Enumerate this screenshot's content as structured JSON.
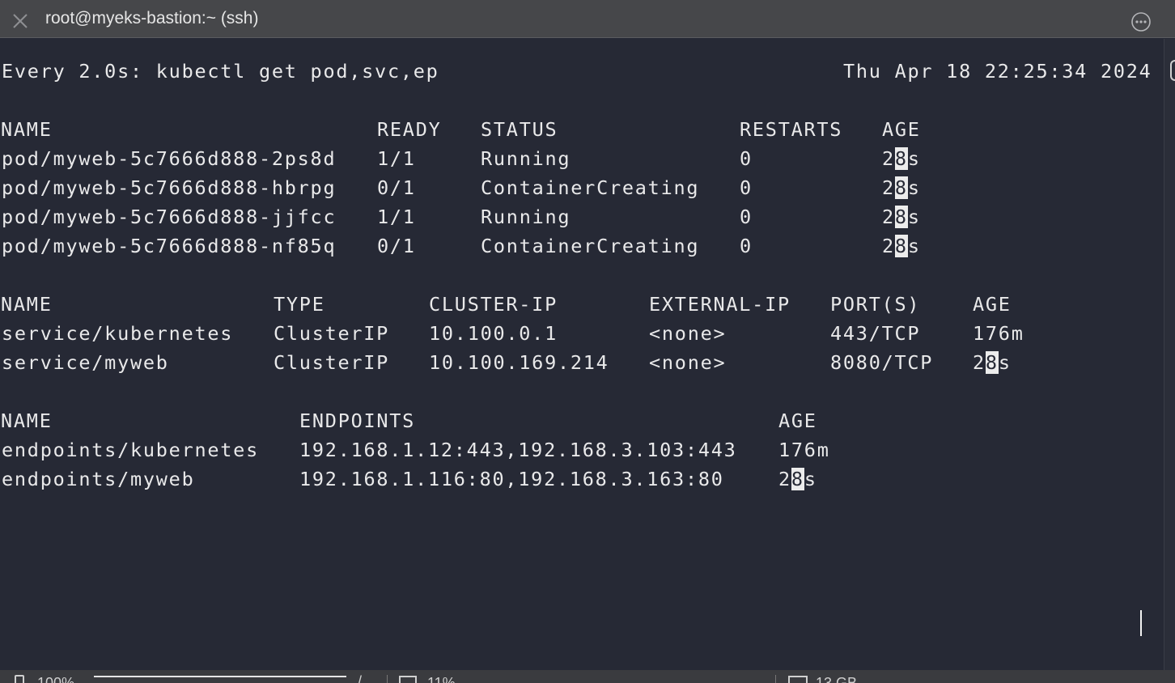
{
  "window": {
    "title": "root@myeks-bastion:~ (ssh)"
  },
  "watch": {
    "header": "Every 2.0s: kubectl get pod,svc,ep",
    "timestamp": "Thu Apr 18 22:25:34 2024"
  },
  "pods": {
    "headers": [
      "NAME",
      "READY",
      "STATUS",
      "RESTARTS",
      "AGE"
    ],
    "rows": [
      {
        "name": "pod/myweb-5c7666d888-2ps8d",
        "ready": "1/1",
        "status": "Running",
        "restarts": "0",
        "age_a": "2",
        "age_b": "8",
        "age_c": "s"
      },
      {
        "name": "pod/myweb-5c7666d888-hbrpg",
        "ready": "0/1",
        "status": "ContainerCreating",
        "restarts": "0",
        "age_a": "2",
        "age_b": "8",
        "age_c": "s"
      },
      {
        "name": "pod/myweb-5c7666d888-jjfcc",
        "ready": "1/1",
        "status": "Running",
        "restarts": "0",
        "age_a": "2",
        "age_b": "8",
        "age_c": "s"
      },
      {
        "name": "pod/myweb-5c7666d888-nf85q",
        "ready": "0/1",
        "status": "ContainerCreating",
        "restarts": "0",
        "age_a": "2",
        "age_b": "8",
        "age_c": "s"
      }
    ]
  },
  "services": {
    "headers": [
      "NAME",
      "TYPE",
      "CLUSTER-IP",
      "EXTERNAL-IP",
      "PORT(S)",
      "AGE"
    ],
    "rows": [
      {
        "name": "service/kubernetes",
        "type": "ClusterIP",
        "cluster_ip": "10.100.0.1",
        "external_ip": "<none>",
        "ports": "443/TCP",
        "age_a": "176m",
        "age_b": "",
        "age_c": ""
      },
      {
        "name": "service/myweb",
        "type": "ClusterIP",
        "cluster_ip": "10.100.169.214",
        "external_ip": "<none>",
        "ports": "8080/TCP",
        "age_a": "2",
        "age_b": "8",
        "age_c": "s"
      }
    ]
  },
  "endpoints": {
    "headers": [
      "NAME",
      "ENDPOINTS",
      "AGE"
    ],
    "rows": [
      {
        "name": "endpoints/kubernetes",
        "endpoints": "192.168.1.12:443,192.168.3.103:443",
        "age_a": "176m",
        "age_b": "",
        "age_c": ""
      },
      {
        "name": "endpoints/myweb",
        "endpoints": "192.168.1.116:80,192.168.3.163:80",
        "age_a": "2",
        "age_b": "8",
        "age_c": "s"
      }
    ]
  },
  "statusbar": {
    "battery": "100%",
    "cpu": "11%",
    "memory": "13 GB"
  },
  "colors": {
    "terminal_bg": "#262935",
    "terminal_fg": "#e9e9ea",
    "titlebar_bg": "#46474a",
    "highlight_bg": "#ececec"
  },
  "icons": [
    "close-icon",
    "more-icon",
    "battery-icon",
    "cpu-icon",
    "memory-icon"
  ]
}
